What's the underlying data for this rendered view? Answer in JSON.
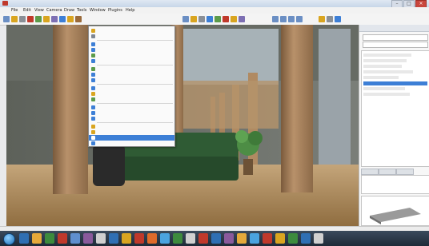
{
  "window": {
    "title": "",
    "min_label": "–",
    "max_label": "□",
    "close_label": "×"
  },
  "menubar": {
    "items": [
      "File",
      "Edit",
      "View",
      "Camera",
      "Draw",
      "Tools",
      "Window",
      "Plugins",
      "Help"
    ]
  },
  "toolbar": {
    "accent": "#d9a520",
    "active": "#3d7fd6"
  },
  "dropdown": {
    "selected_index": 19,
    "selected_color": "#3d7fd6",
    "item_icons": [
      "orange-icon",
      "grid-icon",
      "blue-icon",
      "blue-icon",
      "green-icon",
      "blue-icon",
      "green-icon",
      "blue-icon",
      "blue-icon",
      "blue-icon",
      "orange-icon",
      "green-icon",
      "blue-icon",
      "blue-icon",
      "blue-icon",
      "orange-icon",
      "orange-icon",
      "blue-icon",
      "blue-icon",
      "blue-icon",
      "blue-icon",
      "blue-icon"
    ]
  },
  "right_panel": {
    "panel_title": "",
    "selected_row": 5,
    "selected_color": "#3d7fd6"
  },
  "statusbar": {
    "text": ""
  },
  "taskbar": {
    "app_count": 24,
    "clock_time": "",
    "clock_date": ""
  },
  "scene": {
    "column_color": "#b8916a",
    "sofa_color": "#2f5b34",
    "floor_color": "#a1804f",
    "plant_color": "#4d8d45"
  }
}
